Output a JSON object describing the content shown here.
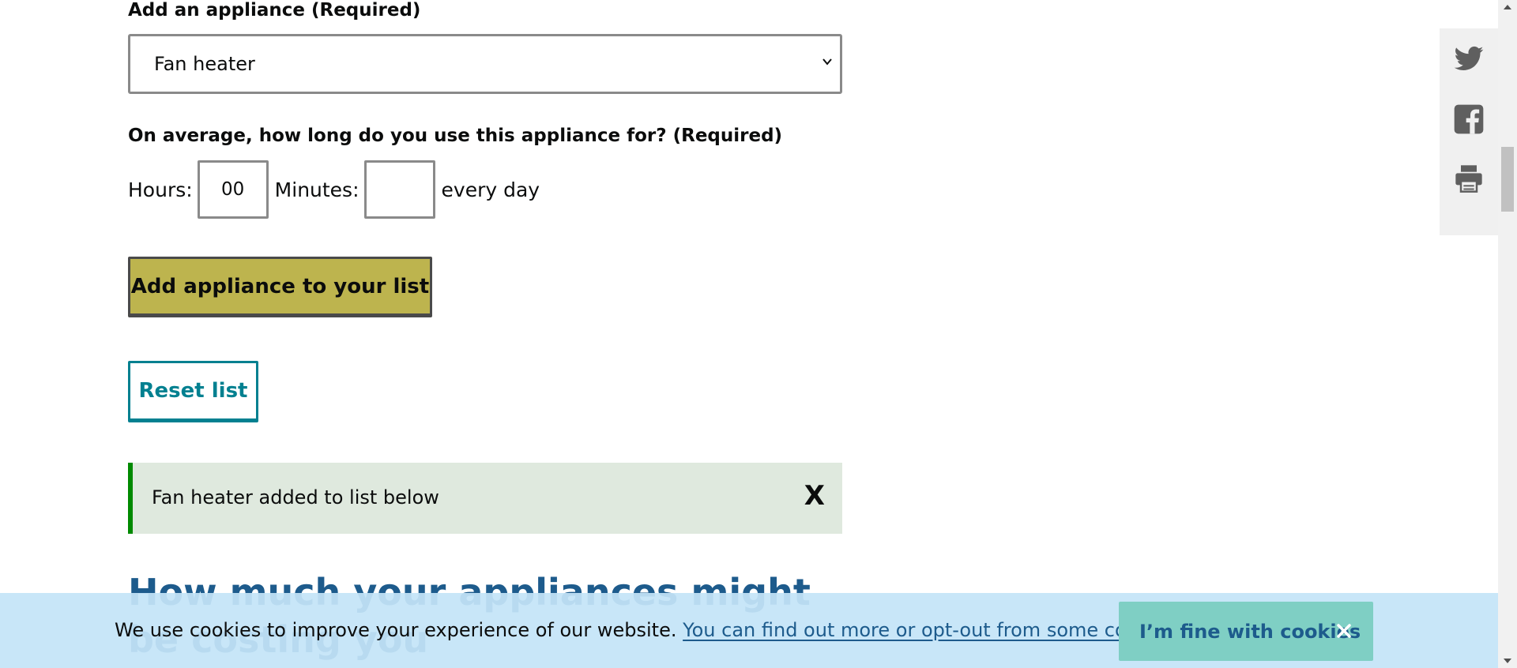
{
  "form": {
    "appliance_label": "Add an appliance (Required)",
    "appliance_selected": "Fan heater",
    "duration_label": "On average, how long do you use this appliance for? (Required)",
    "hours_label": "Hours:",
    "hours_value": "00",
    "minutes_label": "Minutes:",
    "minutes_value": "",
    "suffix": "every day",
    "add_button": "Add appliance to your list",
    "reset_button": "Reset list"
  },
  "notice": {
    "text": "Fan heater added to list below",
    "close": "X"
  },
  "results": {
    "heading": "How much your appliances might be costing you"
  },
  "cookie_banner": {
    "text": "We use cookies to improve your experience of our website.",
    "link": "You can find out more or opt-out from some cookies",
    "period": ".",
    "accept_button": "I’m fine with cookies",
    "close_icon": "close-icon"
  },
  "social": {
    "icons": [
      "twitter-icon",
      "facebook-icon",
      "print-icon"
    ]
  },
  "colors": {
    "add_button_bg": "#bdb44e",
    "reset_accent": "#028090",
    "notice_bg": "#dfe9de",
    "notice_border": "#008a00",
    "heading": "#1d5b8c",
    "cookie_bg": "#c4e4f8",
    "cookie_button": "#7fcfc4"
  }
}
